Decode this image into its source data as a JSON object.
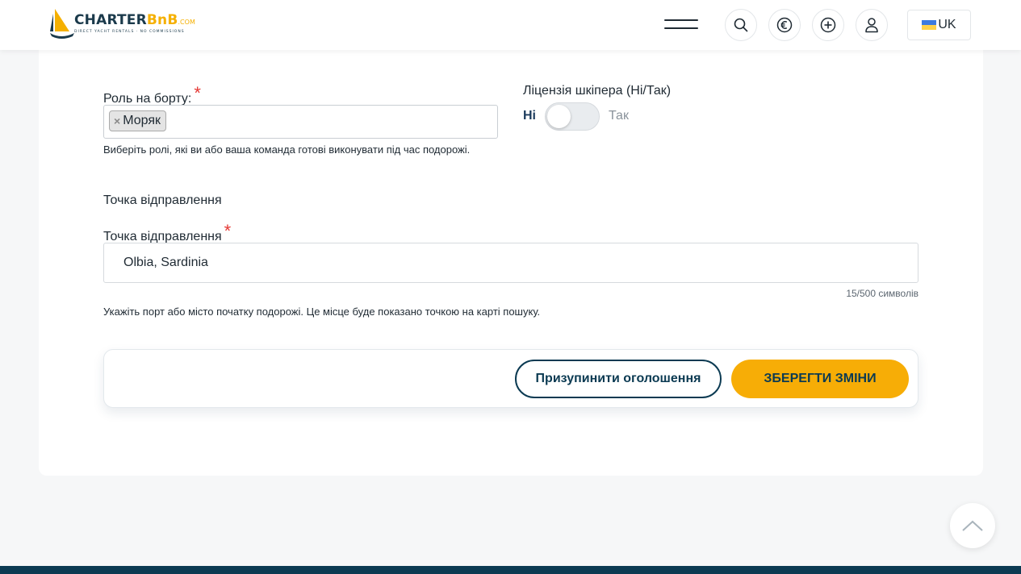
{
  "header": {
    "logo": {
      "brand_main": "CHARTER",
      "brand_accent": "BnB",
      "brand_suffix": ".COM",
      "tagline": "DIRECT YACHT RENTALS · NO COMMISSIONS"
    },
    "icons": [
      "menu-icon",
      "search-icon",
      "euro-icon",
      "plus-circle-icon",
      "user-icon"
    ],
    "language": "UK"
  },
  "form": {
    "role": {
      "label": "Роль на борту:",
      "required_mark": "*",
      "selected": [
        "Моряк"
      ],
      "remove_mark": "×",
      "hint": "Виберіть ролі, які ви або ваша команда готові виконувати під час подорожі."
    },
    "skipper_license": {
      "label": "Ліцензія шкіпера (Ні/Так)",
      "off_label": "Ні",
      "on_label": "Так",
      "value": false
    },
    "departure": {
      "section_title": "Точка відправлення",
      "label": "Точка відправлення",
      "required_mark": "*",
      "value": "Olbia, Sardinia",
      "counter": "15/500 символів",
      "hint": "Укажіть порт або місто початку подорожі. Це місце буде показано точкою на карті пошуку."
    }
  },
  "actions": {
    "pause_label": "Призупинити оголошення",
    "save_label": "ЗБЕРЕГТИ ЗМІНИ"
  },
  "colors": {
    "brand_dark": "#0b3a52",
    "accent_yellow": "#f7ad06",
    "required_red": "#e53935"
  }
}
